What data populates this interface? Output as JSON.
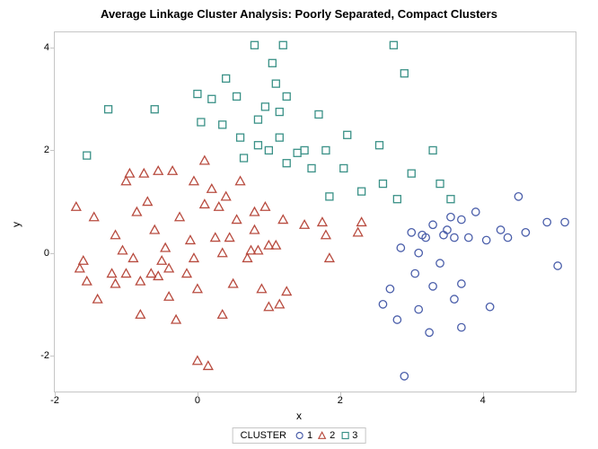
{
  "chart_data": {
    "type": "scatter",
    "title": "Average Linkage Cluster Analysis: Poorly Separated, Compact Clusters",
    "xlabel": "x",
    "ylabel": "y",
    "xlim": [
      -2,
      5.3
    ],
    "ylim": [
      -2.7,
      4.3
    ],
    "xticks": [
      -2,
      0,
      2,
      4
    ],
    "yticks": [
      -2,
      0,
      2,
      4
    ],
    "legend_title": "CLUSTER",
    "series": [
      {
        "name": "1",
        "marker": "circle",
        "color": "#4a5eaa",
        "points": [
          [
            2.6,
            -1.0
          ],
          [
            2.7,
            -0.7
          ],
          [
            2.8,
            -1.3
          ],
          [
            2.85,
            0.1
          ],
          [
            2.9,
            -2.4
          ],
          [
            3.0,
            0.4
          ],
          [
            3.05,
            -0.4
          ],
          [
            3.1,
            -1.1
          ],
          [
            3.1,
            0.0
          ],
          [
            3.15,
            0.35
          ],
          [
            3.2,
            0.3
          ],
          [
            3.25,
            -1.55
          ],
          [
            3.3,
            -0.65
          ],
          [
            3.3,
            0.55
          ],
          [
            3.4,
            -0.2
          ],
          [
            3.45,
            0.35
          ],
          [
            3.5,
            0.45
          ],
          [
            3.55,
            0.7
          ],
          [
            3.6,
            -0.9
          ],
          [
            3.6,
            0.3
          ],
          [
            3.7,
            -0.6
          ],
          [
            3.7,
            -1.45
          ],
          [
            3.7,
            0.65
          ],
          [
            3.8,
            0.3
          ],
          [
            3.9,
            0.8
          ],
          [
            4.05,
            0.25
          ],
          [
            4.1,
            -1.05
          ],
          [
            4.25,
            0.45
          ],
          [
            4.35,
            0.3
          ],
          [
            4.5,
            1.1
          ],
          [
            4.6,
            0.4
          ],
          [
            4.9,
            0.6
          ],
          [
            5.05,
            -0.25
          ],
          [
            5.15,
            0.6
          ]
        ]
      },
      {
        "name": "2",
        "marker": "triangle",
        "color": "#b84b3f",
        "points": [
          [
            -1.7,
            0.9
          ],
          [
            -1.65,
            -0.3
          ],
          [
            -1.6,
            -0.15
          ],
          [
            -1.55,
            -0.55
          ],
          [
            -1.45,
            0.7
          ],
          [
            -1.4,
            -0.9
          ],
          [
            -1.2,
            -0.4
          ],
          [
            -1.15,
            0.35
          ],
          [
            -1.15,
            -0.6
          ],
          [
            -1.05,
            0.05
          ],
          [
            -1.0,
            -0.4
          ],
          [
            -1.0,
            1.4
          ],
          [
            -0.95,
            1.55
          ],
          [
            -0.9,
            -0.1
          ],
          [
            -0.85,
            0.8
          ],
          [
            -0.8,
            -0.55
          ],
          [
            -0.8,
            -1.2
          ],
          [
            -0.75,
            1.55
          ],
          [
            -0.7,
            1.0
          ],
          [
            -0.65,
            -0.4
          ],
          [
            -0.6,
            0.45
          ],
          [
            -0.55,
            1.6
          ],
          [
            -0.55,
            -0.45
          ],
          [
            -0.5,
            -0.15
          ],
          [
            -0.45,
            0.1
          ],
          [
            -0.4,
            -0.85
          ],
          [
            -0.4,
            -0.3
          ],
          [
            -0.35,
            1.6
          ],
          [
            -0.3,
            -1.3
          ],
          [
            -0.25,
            0.7
          ],
          [
            -0.15,
            -0.4
          ],
          [
            -0.1,
            0.25
          ],
          [
            -0.05,
            -0.1
          ],
          [
            -0.05,
            1.4
          ],
          [
            0.0,
            -0.7
          ],
          [
            0.0,
            -2.1
          ],
          [
            0.1,
            0.95
          ],
          [
            0.1,
            1.8
          ],
          [
            0.15,
            -2.2
          ],
          [
            0.2,
            1.25
          ],
          [
            0.25,
            0.3
          ],
          [
            0.3,
            0.9
          ],
          [
            0.35,
            -1.2
          ],
          [
            0.35,
            0.0
          ],
          [
            0.4,
            1.1
          ],
          [
            0.45,
            0.3
          ],
          [
            0.5,
            -0.6
          ],
          [
            0.55,
            0.65
          ],
          [
            0.6,
            1.4
          ],
          [
            0.7,
            -0.1
          ],
          [
            0.75,
            0.05
          ],
          [
            0.8,
            0.8
          ],
          [
            0.8,
            0.45
          ],
          [
            0.85,
            0.05
          ],
          [
            0.9,
            -0.7
          ],
          [
            0.95,
            0.9
          ],
          [
            1.0,
            0.15
          ],
          [
            1.0,
            -1.05
          ],
          [
            1.1,
            0.15
          ],
          [
            1.15,
            -1.0
          ],
          [
            1.2,
            0.65
          ],
          [
            1.25,
            -0.75
          ],
          [
            1.5,
            0.55
          ],
          [
            1.75,
            0.6
          ],
          [
            1.8,
            0.35
          ],
          [
            1.85,
            -0.1
          ],
          [
            2.25,
            0.4
          ],
          [
            2.3,
            0.6
          ]
        ]
      },
      {
        "name": "3",
        "marker": "square",
        "color": "#3a9187",
        "points": [
          [
            -1.55,
            1.9
          ],
          [
            -1.25,
            2.8
          ],
          [
            -0.6,
            2.8
          ],
          [
            0.0,
            3.1
          ],
          [
            0.05,
            2.55
          ],
          [
            0.2,
            3.0
          ],
          [
            0.35,
            2.5
          ],
          [
            0.4,
            3.4
          ],
          [
            0.55,
            3.05
          ],
          [
            0.6,
            2.25
          ],
          [
            0.65,
            1.85
          ],
          [
            0.8,
            4.05
          ],
          [
            0.85,
            2.1
          ],
          [
            0.85,
            2.6
          ],
          [
            0.95,
            2.85
          ],
          [
            1.0,
            2.0
          ],
          [
            1.05,
            3.7
          ],
          [
            1.1,
            3.3
          ],
          [
            1.15,
            2.75
          ],
          [
            1.15,
            2.25
          ],
          [
            1.2,
            4.05
          ],
          [
            1.25,
            3.05
          ],
          [
            1.25,
            1.75
          ],
          [
            1.4,
            1.95
          ],
          [
            1.5,
            2.0
          ],
          [
            1.6,
            1.65
          ],
          [
            1.7,
            2.7
          ],
          [
            1.8,
            2.0
          ],
          [
            1.85,
            1.1
          ],
          [
            2.05,
            1.65
          ],
          [
            2.1,
            2.3
          ],
          [
            2.3,
            1.2
          ],
          [
            2.55,
            2.1
          ],
          [
            2.6,
            1.35
          ],
          [
            2.75,
            4.05
          ],
          [
            2.8,
            1.05
          ],
          [
            2.9,
            3.5
          ],
          [
            3.0,
            1.55
          ],
          [
            3.3,
            2.0
          ],
          [
            3.4,
            1.35
          ],
          [
            3.55,
            1.05
          ]
        ]
      }
    ]
  }
}
